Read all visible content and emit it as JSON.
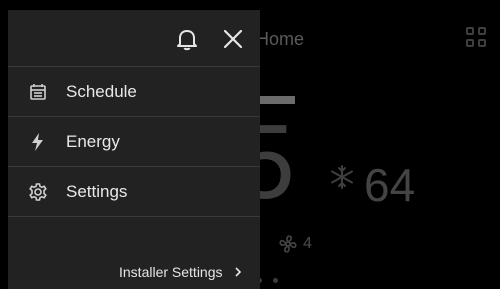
{
  "drawer": {
    "items": [
      {
        "label": "Schedule",
        "icon": "calendar-icon"
      },
      {
        "label": "Energy",
        "icon": "lightning-icon"
      },
      {
        "label": "Settings",
        "icon": "gear-icon"
      }
    ],
    "installer_label": "Installer Settings",
    "installer_chevron": "›"
  },
  "background": {
    "title": "Home",
    "big_digit": "5",
    "cool_setpoint": "64",
    "fan_speed": "4"
  },
  "colors": {
    "drawer_bg": "#222222",
    "background": "#000000",
    "text": "#e8e8e8"
  }
}
